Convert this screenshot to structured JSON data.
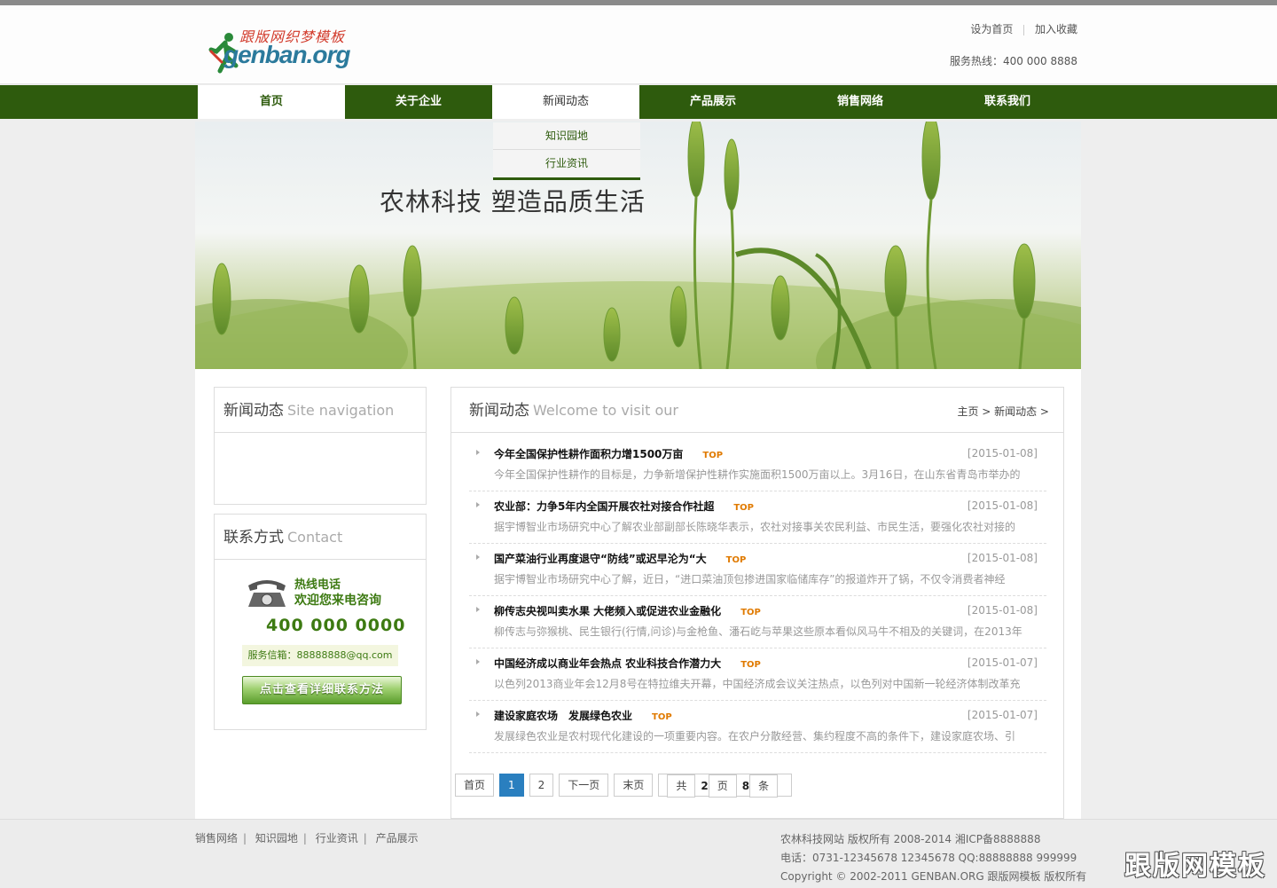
{
  "header": {
    "logo_cn": "跟版网织梦模板",
    "logo_en": "genban.org",
    "top_links": [
      "设为首页",
      "加入收藏"
    ],
    "hotline": "服务热线：400 000 8888"
  },
  "nav": {
    "items": [
      "首页",
      "关于企业",
      "新闻动态",
      "产品展示",
      "销售网络",
      "联系我们"
    ],
    "submenu": [
      "知识园地",
      "行业资讯"
    ]
  },
  "banner": {
    "slogan": "农林科技  塑造品质生活"
  },
  "side_nav": {
    "title": "新闻动态",
    "subtitle": "Site navigation"
  },
  "contact": {
    "title": "联系方式",
    "subtitle": "Contact",
    "hotline_label": "热线电话",
    "welcome": "欢迎您来电咨询",
    "number": "400 000 0000",
    "email": "服务信箱：88888888@qq.com",
    "detail_button": "点击查看详细联系方法"
  },
  "news": {
    "title": "新闻动态",
    "subtitle": "Welcome to visit our",
    "breadcrumb": "主页 > 新闻动态 >",
    "top_label": "TOP",
    "items": [
      {
        "title": "今年全国保护性耕作面积力增1500万亩",
        "date": "[2015-01-08]",
        "summary": "今年全国保护性耕作的目标是，力争新增保护性耕作实施面积1500万亩以上。3月16日，在山东省青岛市举办的"
      },
      {
        "title": "农业部：力争5年内全国开展农社对接合作社超",
        "date": "[2015-01-08]",
        "summary": "据宇博智业市场研究中心了解农业部副部长陈晓华表示，农社对接事关农民利益、市民生活，要强化农社对接的"
      },
      {
        "title": "国产菜油行业再度退守“防线”或迟早沦为“大",
        "date": "[2015-01-08]",
        "summary": "据宇博智业市场研究中心了解，近日，“进口菜油顶包掺进国家临储库存”的报道炸开了锅，不仅令消费者神经"
      },
      {
        "title": "柳传志央视叫卖水果 大佬频入或促进农业金融化",
        "date": "[2015-01-08]",
        "summary": "柳传志与弥猴桃、民生银行(行情,问诊)与金枪鱼、潘石屹与苹果这些原本看似风马牛不相及的关键词，在2013年"
      },
      {
        "title": "中国经济成以商业年会热点 农业科技合作潜力大",
        "date": "[2015-01-07]",
        "summary": "以色列2013商业年会12月8号在特拉维夫开幕，中国经济成会议关注热点，以色列对中国新一轮经济体制改革充"
      },
      {
        "title": "建设家庭农场　发展绿色农业",
        "date": "[2015-01-07]",
        "summary": "发展绿色农业是农村现代化建设的一项重要内容。在农户分散经营、集约程度不高的条件下，建设家庭农场、引"
      }
    ]
  },
  "pager": {
    "first": "首页",
    "pages": [
      "1",
      "2"
    ],
    "next": "下一页",
    "last": "末页",
    "total_prefix": "共 ",
    "total_pages": "2",
    "total_mid": "页",
    "total_count": "8",
    "total_suffix": "条"
  },
  "footer": {
    "links": [
      "销售网络",
      "知识园地",
      "行业资讯",
      "产品展示"
    ],
    "line1": "农林科技网站 版权所有 2008-2014 湘ICP备8888888",
    "line2": "电话：0731-12345678 12345678 QQ:88888888 999999",
    "line3": "Copyright © 2002-2011 GENBAN.ORG 跟版网模板 版权所有",
    "watermark": "跟版网模板"
  },
  "colors": {
    "nav_green": "#2e5b0d",
    "accent_green": "#3d7a12",
    "top_orange": "#e07a00",
    "pager_blue": "#2a7fbf"
  }
}
